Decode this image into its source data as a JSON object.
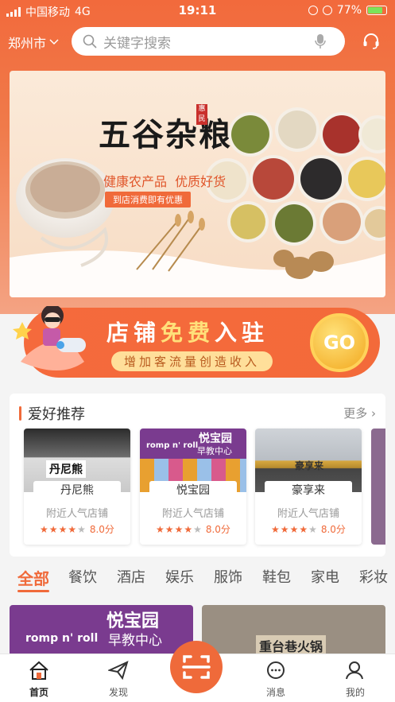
{
  "status": {
    "carrier": "中国移动",
    "network": "4G",
    "time": "19:11",
    "battery": "77%"
  },
  "header": {
    "city": "郑州市",
    "search_placeholder": "关键字搜索"
  },
  "banner": {
    "title": "五谷杂粮",
    "tagline": "健康农产品  优质好货",
    "button": "到店消费即有优惠",
    "seal": "惠民"
  },
  "promo": {
    "title": "店铺免费入驻",
    "title_a": "店铺",
    "title_b": "免费",
    "title_c": "入驻",
    "subtitle": "增加客流量创造收入",
    "go": "GO"
  },
  "recommend": {
    "title": "爱好推荐",
    "more": "更多",
    "shops": [
      {
        "name": "丹尼熊",
        "sign": "丹尼熊",
        "sub": "附近人气店铺",
        "rating": "8.0分",
        "stars": 4
      },
      {
        "name": "悦宝园",
        "sign": "悦宝园",
        "sign2": "早教中心",
        "brand": "romp n' roll",
        "sub": "附近人气店铺",
        "rating": "8.0分",
        "stars": 4
      },
      {
        "name": "豪享来",
        "sign": "豪享来",
        "sub": "附近人气店铺",
        "rating": "8.0分",
        "stars": 4
      }
    ]
  },
  "categories": [
    "全部",
    "餐饮",
    "酒店",
    "娱乐",
    "服饰",
    "鞋包",
    "家电",
    "彩妆"
  ],
  "feed": [
    {
      "brand": "romp n' roll",
      "title": "悦宝园",
      "subtitle": "早教中心"
    },
    {
      "title": "重台巷火锅"
    }
  ],
  "tabbar": [
    {
      "label": "首页",
      "icon": "home-icon"
    },
    {
      "label": "发现",
      "icon": "paper-plane-icon"
    },
    {
      "label": "",
      "icon": "scan-icon"
    },
    {
      "label": "消息",
      "icon": "chat-icon"
    },
    {
      "label": "我的",
      "icon": "user-icon"
    }
  ],
  "colors": {
    "accent": "#f06a3a",
    "header": "#f26a3c"
  }
}
